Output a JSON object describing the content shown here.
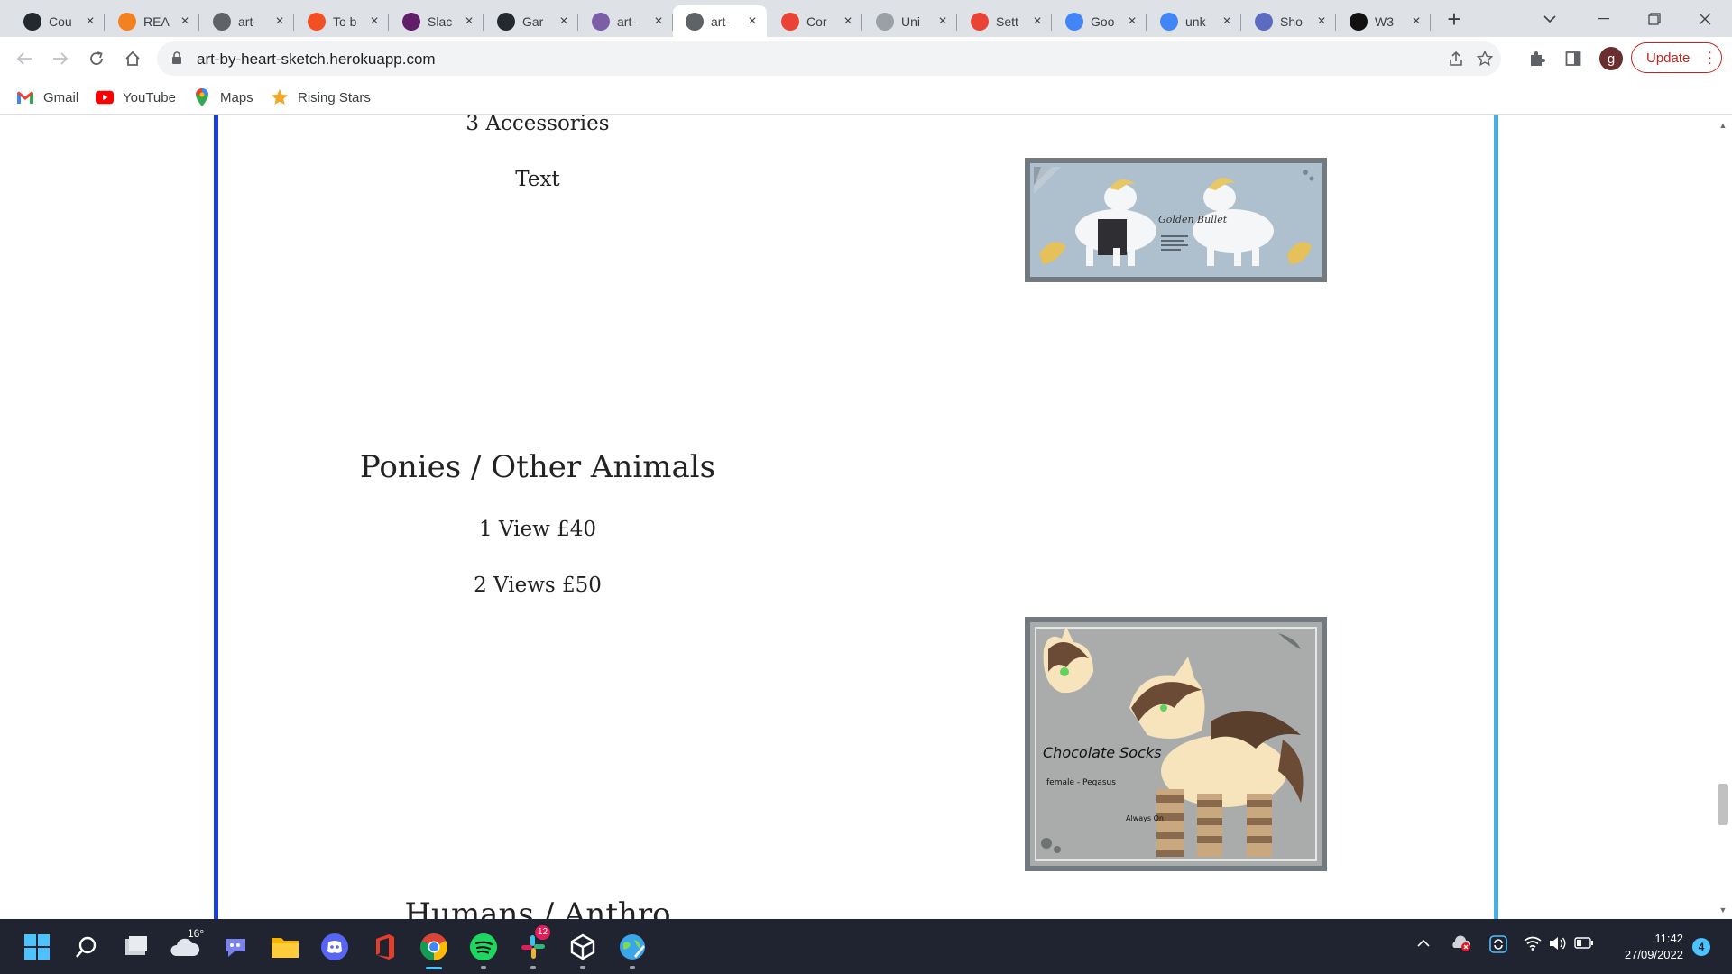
{
  "browser": {
    "tabs": [
      {
        "title": "Cou",
        "icon": "github-icon",
        "color": "#24292f",
        "active": false
      },
      {
        "title": "REA",
        "icon": "google-docs-icon",
        "color": "#f4811f",
        "active": false
      },
      {
        "title": "art-",
        "icon": "globe-icon",
        "color": "#5f6368",
        "active": false
      },
      {
        "title": "To b",
        "icon": "todoist-icon",
        "color": "#f25022",
        "active": false
      },
      {
        "title": "Slac",
        "icon": "slack-icon",
        "color": "#611f69",
        "active": false
      },
      {
        "title": "Gar",
        "icon": "github-icon",
        "color": "#24292f",
        "active": false
      },
      {
        "title": "art-",
        "icon": "heroku-icon",
        "color": "#7b5ea7",
        "active": false
      },
      {
        "title": "art-",
        "icon": "globe-icon",
        "color": "#5f6368",
        "active": true
      },
      {
        "title": "Cor",
        "icon": "gmail-icon",
        "color": "#ea4335",
        "active": false
      },
      {
        "title": "Uni",
        "icon": "unity-icon",
        "color": "#9aa0a6",
        "active": false
      },
      {
        "title": "Sett",
        "icon": "gmail-icon",
        "color": "#ea4335",
        "active": false
      },
      {
        "title": "Goo",
        "icon": "google-icon",
        "color": "#4285f4",
        "active": false
      },
      {
        "title": "unk",
        "icon": "google-icon",
        "color": "#4285f4",
        "active": false
      },
      {
        "title": "Sho",
        "icon": "shopify-icon",
        "color": "#5c6bc0",
        "active": false
      },
      {
        "title": "W3",
        "icon": "w3schools-icon",
        "color": "#111111",
        "active": false
      }
    ],
    "new_tab_label": "+",
    "url": "art-by-heart-sketch.herokuapp.com",
    "update_label": "Update",
    "profile_initial": "g",
    "bookmarks": [
      {
        "label": "Gmail",
        "icon": "gmail-icon"
      },
      {
        "label": "YouTube",
        "icon": "youtube-icon"
      },
      {
        "label": "Maps",
        "icon": "maps-pin-icon"
      },
      {
        "label": "Rising Stars",
        "icon": "star-icon"
      }
    ]
  },
  "page": {
    "items": [
      {
        "kind": "line",
        "text": "3 Accessories"
      },
      {
        "kind": "line",
        "text": "Text"
      },
      {
        "kind": "heading",
        "text": "Ponies / Other Animals"
      },
      {
        "kind": "line",
        "text": "1 View £40"
      },
      {
        "kind": "line",
        "text": "2 Views £50"
      },
      {
        "kind": "heading",
        "text": "Humans / Anthro"
      }
    ],
    "images": [
      {
        "name": "golden-bullet-reference-image",
        "caption": "Golden Bullet"
      },
      {
        "name": "chocolate-socks-reference-image",
        "caption": "Chocolate Socks",
        "subcaption": "female - Pegasus",
        "note": "Always On"
      }
    ],
    "colors": {
      "left_rule": "#1a3fdb",
      "right_rule": "#4aaee6"
    }
  },
  "taskbar": {
    "weather": "16°",
    "slack_badge": "12",
    "time": "11:42",
    "date": "27/09/2022",
    "notifications": "4"
  }
}
